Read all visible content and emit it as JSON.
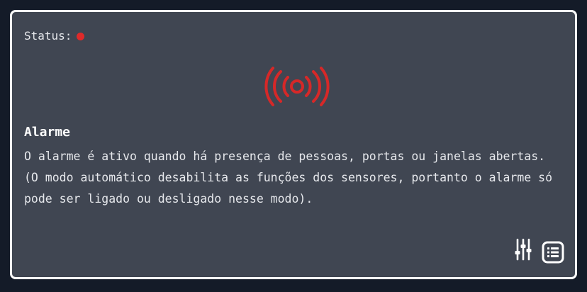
{
  "card": {
    "status_label": "Status:",
    "status_color": "#e02a2a",
    "icon": "alarm-broadcast-icon",
    "icon_color": "#d62828",
    "title": "Alarme",
    "description_line1": "O alarme é ativo quando há presença de pessoas, portas ou janelas abertas.",
    "description_line2": "(O modo automático desabilita as funções dos sensores, portanto o alarme só pode ser ligado ou desligado nesse modo).",
    "actions": [
      {
        "icon": "sliders-icon"
      },
      {
        "icon": "list-icon"
      }
    ],
    "background": "#404652",
    "border_color": "#ffffff"
  }
}
